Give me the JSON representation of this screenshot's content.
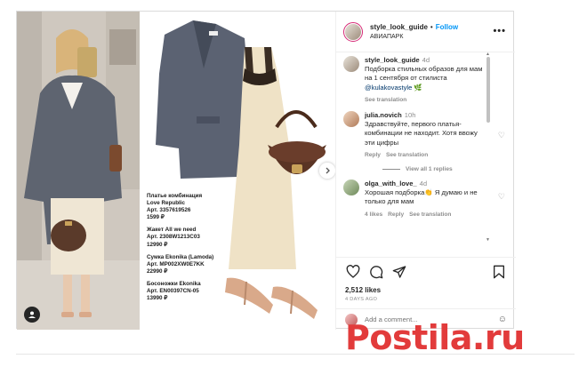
{
  "post": {
    "author": "style_look_guide",
    "follow_label": "Follow",
    "location": "АВИАПАРК",
    "more_label": "•••"
  },
  "caption_items": [
    {
      "lines": [
        "Платье комбинация",
        "Love Republic",
        "Арт. 3357619526",
        "1599 ₽"
      ]
    },
    {
      "lines": [
        "Жакет All we need",
        "Арт. 2308W1213C03",
        "12990 ₽"
      ]
    },
    {
      "lines": [
        "Сумка Ekonika (Lamoda)",
        "Арт. MP002XW0E7KK",
        "22990 ₽"
      ]
    },
    {
      "lines": [
        "Босоножки Ekonika",
        "Арт. EN00397CN-05",
        "13990 ₽"
      ]
    }
  ],
  "comments": [
    {
      "user": "style_look_guide",
      "time": "4d",
      "text": "Подборка стильных образов для мам на 1 сентября от стилиста",
      "mention": "@kulakovastyle",
      "emoji": "🌿",
      "meta": [
        "See translation"
      ]
    },
    {
      "user": "julia.novich",
      "time": "10h",
      "text": "Здравствуйте, первого платья-комбинации не находит. Хотя ввожу эти цифры",
      "meta": [
        "Reply",
        "See translation"
      ]
    },
    {
      "user": "olga_with_love_",
      "time": "4d",
      "text": "Хорошая подборка👏 Я думаю и не только для мам",
      "meta": [
        "4 likes",
        "Reply",
        "See translation"
      ]
    }
  ],
  "view_replies_label": "View all 1 replies",
  "likes": "2,512 likes",
  "date": "4 DAYS AGO",
  "add_comment_placeholder": "Add a comment...",
  "watermark": "Postila.ru",
  "colors": {
    "follow": "#0095f6",
    "watermark": "#e23b3b",
    "muted": "#8e8e8e"
  }
}
